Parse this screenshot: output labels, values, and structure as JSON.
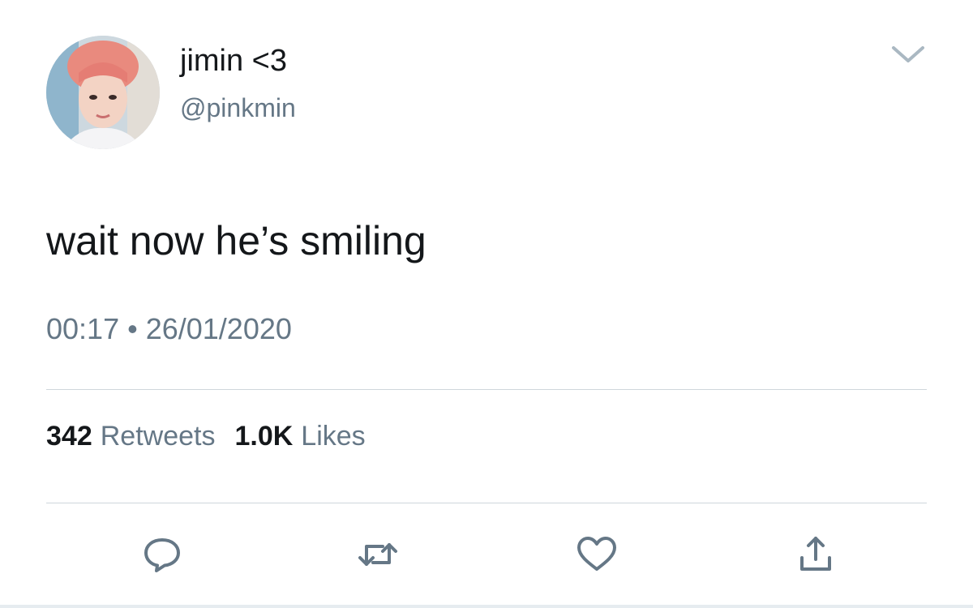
{
  "tweet": {
    "display_name": "jimin <3",
    "handle": "@pinkmin",
    "text": "wait now he’s smiling",
    "time": "00:17",
    "separator": "•",
    "date": "26/01/2020"
  },
  "stats": {
    "retweets_count": "342",
    "retweets_label": "Retweets",
    "likes_count": "1.0K",
    "likes_label": "Likes"
  },
  "icons": {
    "more": "chevron-down-icon",
    "reply": "reply-icon",
    "retweet": "retweet-icon",
    "like": "heart-icon",
    "share": "share-icon"
  },
  "colors": {
    "text_primary": "#14171a",
    "text_secondary": "#657786",
    "divider": "#cfd6dc",
    "icon": "#657786"
  }
}
